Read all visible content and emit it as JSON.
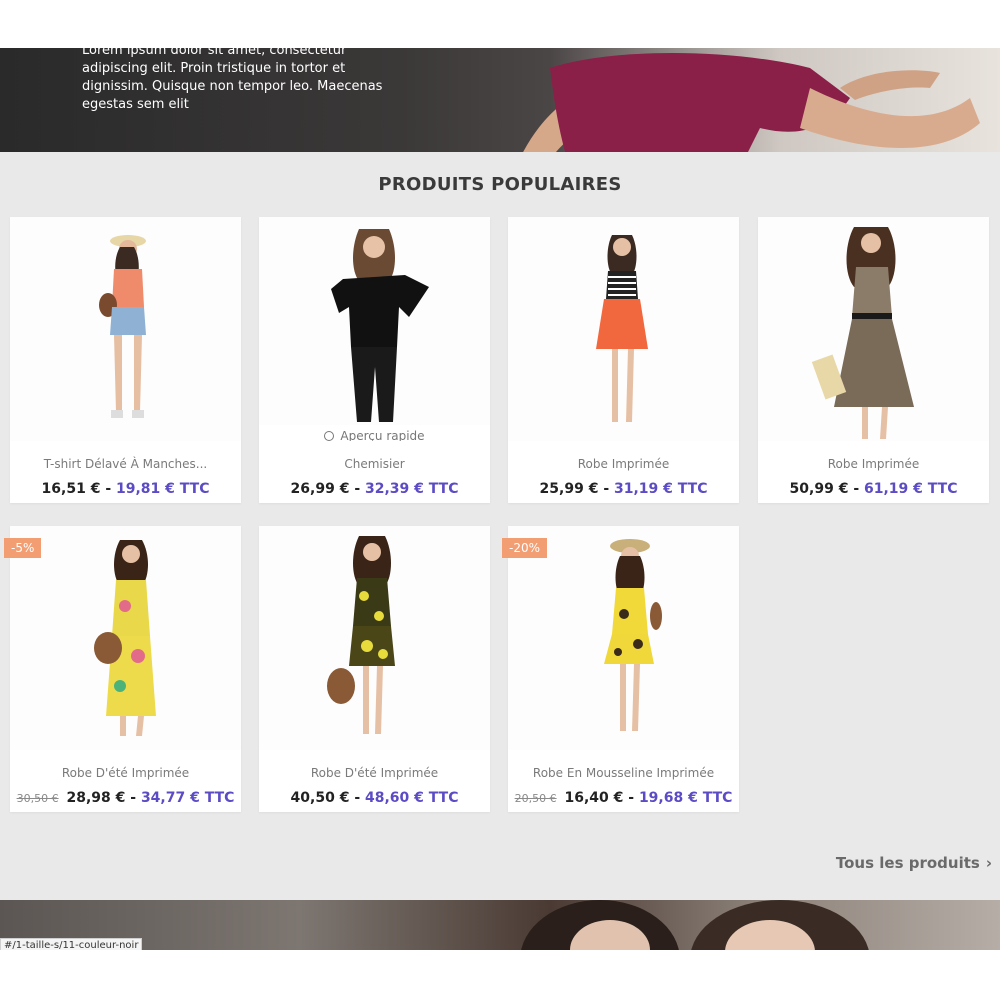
{
  "hero": {
    "text": "Lorem ipsum dolor sit amet, consectetur adipiscing elit. Proin tristique in tortor et dignissim. Quisque non tempor leo. Maecenas egestas sem elit"
  },
  "section": {
    "title": "PRODUITS POPULAIRES"
  },
  "products": [
    {
      "name": "T-shirt Délavé À Manches...",
      "price": "16,51 €",
      "separator": "-",
      "price_ttc": "19,81 € TTC"
    },
    {
      "name": "Chemisier",
      "price": "26,99 €",
      "separator": "-",
      "price_ttc": "32,39 € TTC",
      "quick_view": "Aperçu rapide"
    },
    {
      "name": "Robe Imprimée",
      "price": "25,99 €",
      "separator": "-",
      "price_ttc": "31,19 € TTC"
    },
    {
      "name": "Robe Imprimée",
      "price": "50,99 €",
      "separator": "-",
      "price_ttc": "61,19 € TTC"
    },
    {
      "name": "Robe D'été Imprimée",
      "old_price": "30,50 €",
      "price": "28,98 €",
      "separator": "-",
      "price_ttc": "34,77 € TTC",
      "discount": "-5%"
    },
    {
      "name": "Robe D'été Imprimée",
      "price": "40,50 €",
      "separator": "-",
      "price_ttc": "48,60 € TTC"
    },
    {
      "name": "Robe En Mousseline Imprimée",
      "old_price": "20,50 €",
      "price": "16,40 €",
      "separator": "-",
      "price_ttc": "19,68 € TTC",
      "discount": "-20%"
    }
  ],
  "footer_link": {
    "label": "Tous les produits",
    "chevron": "›"
  },
  "status_url": "#/1-taille-s/11-couleur-noir",
  "colors": {
    "ttc": "#5b4bc4",
    "discount_badge": "#f39d72",
    "background": "#e9e9e9"
  }
}
